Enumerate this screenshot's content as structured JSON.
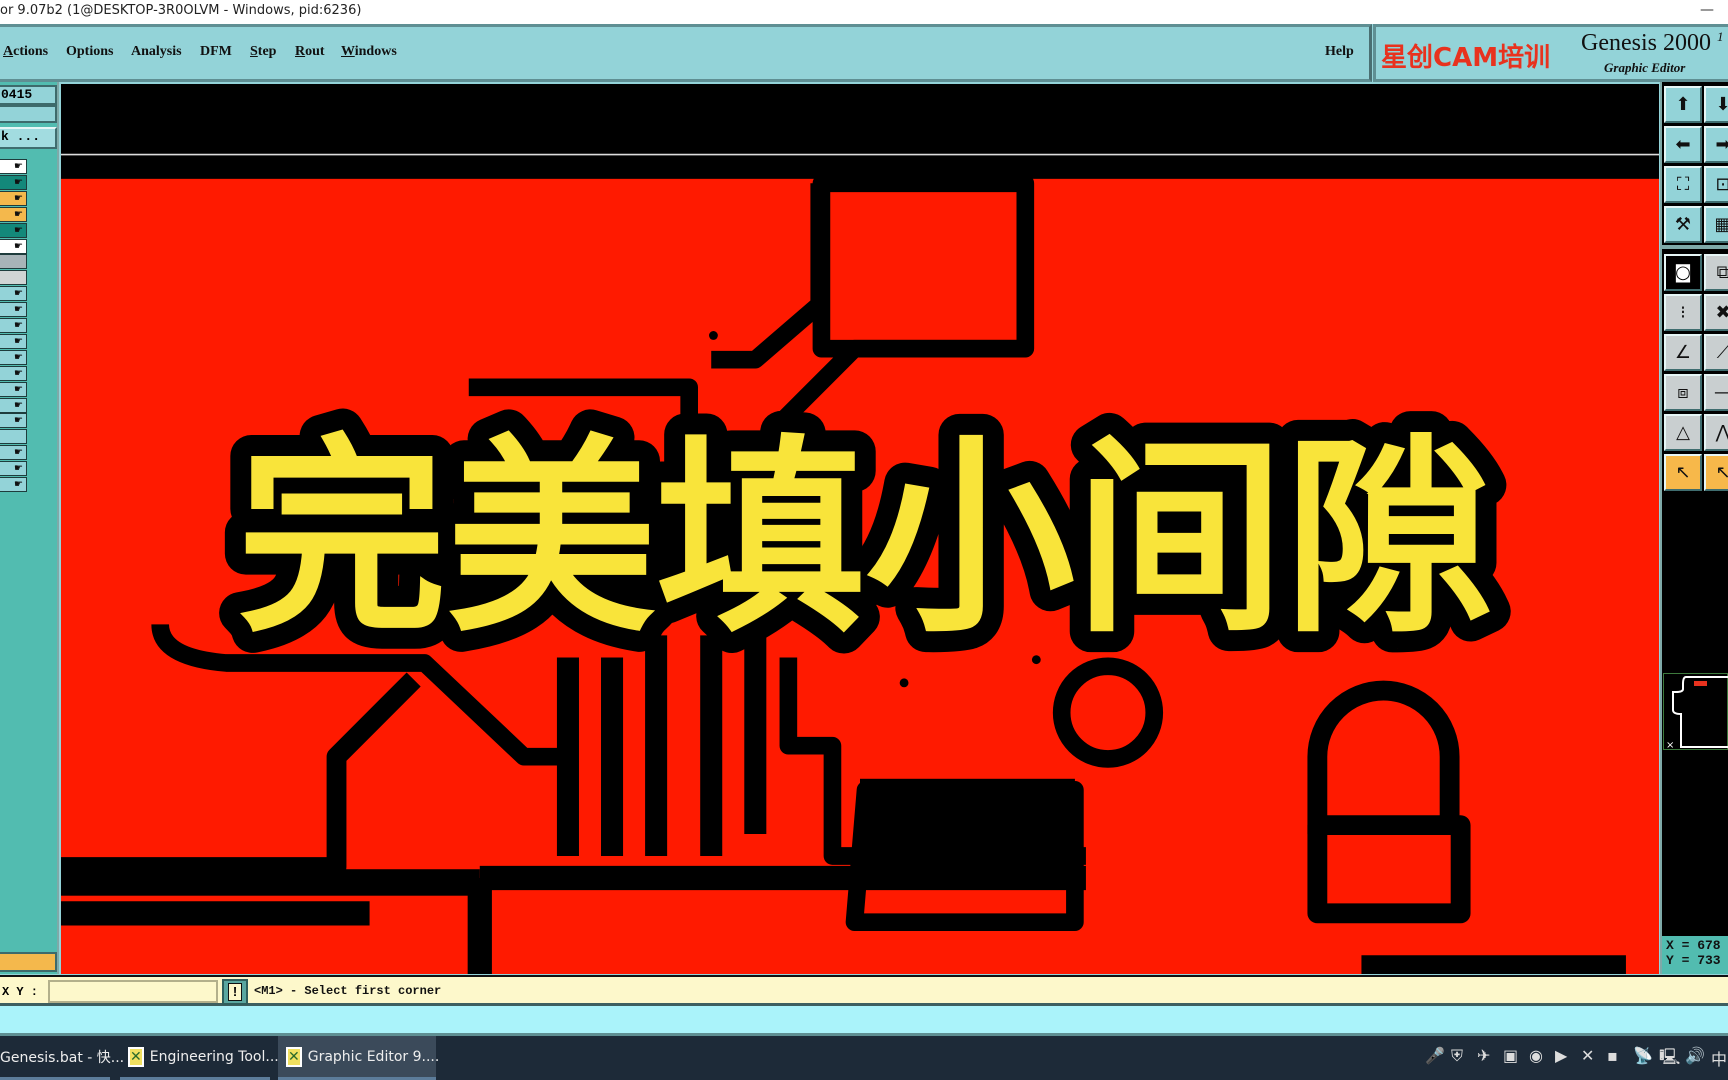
{
  "window": {
    "title": "or 9.07b2 (1@DESKTOP-3R0OLVM - Windows, pid:6236)",
    "minimize": "—"
  },
  "menu": {
    "items": [
      {
        "label": "Actions",
        "ul": "A",
        "rest": "ctions"
      },
      {
        "label": "Options"
      },
      {
        "label": "Analysis"
      },
      {
        "label": "DFM"
      },
      {
        "label": "Step",
        "ul": "S",
        "rest": "tep"
      },
      {
        "label": "Rout",
        "ul": "R",
        "rest": "out"
      },
      {
        "label": "Windows",
        "ul": "W",
        "rest": "indows"
      }
    ],
    "help": "Help"
  },
  "brand": {
    "cn": "星创CAM培训",
    "title": "Genesis 2000",
    "suffix": "1",
    "subtitle": "Graphic Editor",
    "cn_color": "#e8321e"
  },
  "left_panel": {
    "job_field": "0415",
    "step_button": "k ...",
    "rows": [
      {
        "color": "#ffffff",
        "hand": true
      },
      {
        "color": "#13887a",
        "hand": true
      },
      {
        "color": "#f4b84c",
        "hand": true,
        "extra": "⊞"
      },
      {
        "color": "#f4b84c",
        "hand": true
      },
      {
        "color": "#13887a",
        "hand": true
      },
      {
        "color": "#ffffff",
        "hand": true
      },
      {
        "color": "#a8b4b8",
        "hand": false
      },
      {
        "color": "#d0d4d4",
        "hand": false
      },
      {
        "color": "#93d3d8",
        "hand": true
      },
      {
        "color": "#93d3d8",
        "hand": true
      },
      {
        "color": "#93d3d8",
        "hand": true
      },
      {
        "color": "#93d3d8",
        "hand": true
      },
      {
        "color": "#93d3d8",
        "hand": true
      },
      {
        "color": "#93d3d8",
        "hand": true
      },
      {
        "color": "#93d3d8",
        "hand": true
      },
      {
        "color": "#93d3d8",
        "hand": true
      },
      {
        "color": "#93d3d8",
        "hand": true
      },
      {
        "color": "#93d3d8",
        "hand": false
      },
      {
        "color": "#93d3d8",
        "hand": true
      },
      {
        "color": "#93d3d8",
        "hand": true
      },
      {
        "color": "#93d3d8",
        "hand": true
      }
    ]
  },
  "canvas": {
    "overlay_caption": "完美填小间隙",
    "copper_color": "#ff1a00",
    "caption_color": "#f9e43a"
  },
  "right_toolbar": {
    "buttons": [
      {
        "icon": "pan-up-icon",
        "glyph": "⬆"
      },
      {
        "icon": "pan-down-icon",
        "glyph": "⬇"
      },
      {
        "icon": "pan-left-icon",
        "glyph": "⬅"
      },
      {
        "icon": "pan-right-icon",
        "glyph": "➡"
      },
      {
        "icon": "zoom-fit-icon",
        "glyph": "⛶"
      },
      {
        "icon": "zoom-center-icon",
        "glyph": "⊡"
      },
      {
        "icon": "measure-tool-icon",
        "glyph": "⚒"
      },
      {
        "icon": "grid-icon",
        "glyph": "▦"
      },
      {
        "icon": "snap-icon",
        "glyph": "◙"
      },
      {
        "icon": "add-shape-icon",
        "glyph": "⧉"
      },
      {
        "icon": "connect-icon",
        "glyph": "⁝"
      },
      {
        "icon": "delete-point-icon",
        "glyph": "✖"
      },
      {
        "icon": "line-angle-icon",
        "glyph": "∠"
      },
      {
        "icon": "line-draw-icon",
        "glyph": "⟋"
      },
      {
        "icon": "move-pad-icon",
        "glyph": "⧈"
      },
      {
        "icon": "line-mid-icon",
        "glyph": "—"
      },
      {
        "icon": "triangle-icon",
        "glyph": "△"
      },
      {
        "icon": "peak-icon",
        "glyph": "⋀"
      },
      {
        "icon": "select-arrow-icon",
        "glyph": "↖"
      },
      {
        "icon": "select-box-icon",
        "glyph": "↖"
      }
    ]
  },
  "coords": {
    "x": "X = 678",
    "y": "Y = 733"
  },
  "command_line": {
    "label": "X Y :",
    "input_value": "",
    "exec": "!",
    "prompt": "<M1> - Select first corner"
  },
  "taskbar": {
    "items": [
      {
        "label": "Genesis.bat - 快...",
        "active": false
      },
      {
        "label": "Engineering Tool...",
        "active": false
      },
      {
        "label": "Graphic Editor 9....",
        "active": true
      }
    ],
    "tray": [
      "🎤",
      "⛨",
      "✈",
      "▣",
      "◉",
      "▶",
      "✕",
      "▪",
      "📡",
      "🖳",
      "🔊",
      "中"
    ]
  }
}
